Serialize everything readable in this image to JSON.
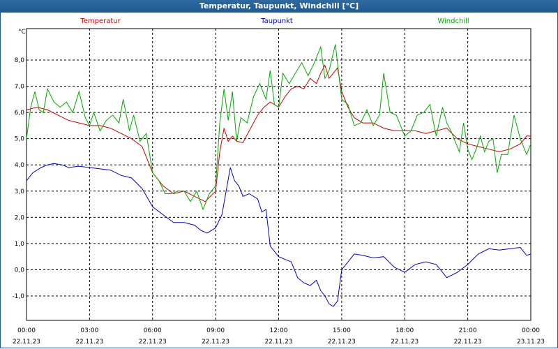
{
  "window": {
    "title": "Temperatur, Taupunkt, Windchill [°C]"
  },
  "chart_data": {
    "type": "line",
    "title": "Temperatur, Taupunkt, Windchill [°C]",
    "ylabel": "°C",
    "ylim": [
      -2.0,
      9.0
    ],
    "yticks": [
      -1.0,
      0.0,
      1.0,
      2.0,
      3.0,
      4.0,
      5.0,
      6.0,
      7.0,
      8.0
    ],
    "ytick_labels": [
      "-1,0",
      "0,0",
      "1,0",
      "2,0",
      "3,0",
      "4,0",
      "5,0",
      "6,0",
      "7,0",
      "8,0"
    ],
    "xlim": [
      0,
      24
    ],
    "xticks": [
      {
        "time": "00:00",
        "date": "22.11.23"
      },
      {
        "time": "03:00",
        "date": "22.11.23"
      },
      {
        "time": "06:00",
        "date": "22.11.23"
      },
      {
        "time": "09:00",
        "date": "22.11.23"
      },
      {
        "time": "12:00",
        "date": "22.11.23"
      },
      {
        "time": "15:00",
        "date": "22.11.23"
      },
      {
        "time": "18:00",
        "date": "22.11.23"
      },
      {
        "time": "21:00",
        "date": "22.11.23"
      },
      {
        "time": "00:00",
        "date": "23.11.23"
      }
    ],
    "grid": true,
    "legend_position": "top",
    "series": [
      {
        "name": "Temperatur",
        "color": "#cc0000",
        "points": [
          [
            0,
            6.1
          ],
          [
            0.5,
            6.2
          ],
          [
            1,
            6.1
          ],
          [
            1.5,
            5.9
          ],
          [
            2,
            5.7
          ],
          [
            2.5,
            5.6
          ],
          [
            3,
            5.5
          ],
          [
            3.5,
            5.5
          ],
          [
            4,
            5.4
          ],
          [
            4.5,
            5.2
          ],
          [
            5,
            5.0
          ],
          [
            5.5,
            4.7
          ],
          [
            6,
            3.7
          ],
          [
            6.5,
            3.2
          ],
          [
            7,
            2.9
          ],
          [
            7.5,
            3.0
          ],
          [
            8,
            2.8
          ],
          [
            8.5,
            2.6
          ],
          [
            9,
            3.0
          ],
          [
            9.2,
            4.5
          ],
          [
            9.4,
            5.4
          ],
          [
            9.6,
            4.9
          ],
          [
            9.8,
            5.1
          ],
          [
            10,
            4.9
          ],
          [
            10.3,
            4.85
          ],
          [
            10.6,
            5.3
          ],
          [
            11,
            5.9
          ],
          [
            11.3,
            6.2
          ],
          [
            11.6,
            6.4
          ],
          [
            12,
            6.2
          ],
          [
            12.3,
            6.6
          ],
          [
            12.6,
            6.9
          ],
          [
            12.9,
            7.0
          ],
          [
            13.2,
            6.9
          ],
          [
            13.5,
            7.3
          ],
          [
            13.8,
            7.1
          ],
          [
            14,
            7.5
          ],
          [
            14.2,
            7.8
          ],
          [
            14.4,
            7.3
          ],
          [
            14.6,
            7.5
          ],
          [
            14.8,
            7.7
          ],
          [
            15,
            6.8
          ],
          [
            15.3,
            6.2
          ],
          [
            15.6,
            5.8
          ],
          [
            16,
            5.6
          ],
          [
            16.5,
            5.6
          ],
          [
            17,
            5.4
          ],
          [
            17.5,
            5.3
          ],
          [
            18,
            5.3
          ],
          [
            18.5,
            5.3
          ],
          [
            19,
            5.2
          ],
          [
            19.5,
            5.3
          ],
          [
            20,
            5.4
          ],
          [
            20.5,
            5.0
          ],
          [
            21,
            4.8
          ],
          [
            21.5,
            4.7
          ],
          [
            22,
            4.6
          ],
          [
            22.5,
            4.5
          ],
          [
            23,
            4.6
          ],
          [
            23.5,
            4.8
          ],
          [
            23.8,
            5.1
          ],
          [
            24,
            5.1
          ]
        ]
      },
      {
        "name": "Taupunkt",
        "color": "#0000cc",
        "points": [
          [
            0,
            3.4
          ],
          [
            0.3,
            3.7
          ],
          [
            0.7,
            3.9
          ],
          [
            1,
            4.0
          ],
          [
            1.3,
            4.05
          ],
          [
            1.7,
            4.0
          ],
          [
            2,
            3.9
          ],
          [
            2.5,
            3.95
          ],
          [
            3,
            3.9
          ],
          [
            3.5,
            3.85
          ],
          [
            4,
            3.8
          ],
          [
            4.5,
            3.6
          ],
          [
            5,
            3.5
          ],
          [
            5.5,
            3.1
          ],
          [
            6,
            2.4
          ],
          [
            6.5,
            2.1
          ],
          [
            7,
            1.8
          ],
          [
            7.5,
            1.8
          ],
          [
            8,
            1.7
          ],
          [
            8.3,
            1.5
          ],
          [
            8.6,
            1.4
          ],
          [
            9,
            1.6
          ],
          [
            9.3,
            2.1
          ],
          [
            9.5,
            3.0
          ],
          [
            9.7,
            3.9
          ],
          [
            9.9,
            3.4
          ],
          [
            10.1,
            3.2
          ],
          [
            10.3,
            2.8
          ],
          [
            10.6,
            2.9
          ],
          [
            11,
            2.7
          ],
          [
            11.2,
            2.2
          ],
          [
            11.4,
            2.3
          ],
          [
            11.6,
            0.9
          ],
          [
            12,
            0.5
          ],
          [
            12.3,
            0.4
          ],
          [
            12.6,
            0.3
          ],
          [
            12.9,
            -0.3
          ],
          [
            13.2,
            -0.5
          ],
          [
            13.5,
            -0.6
          ],
          [
            13.8,
            -0.4
          ],
          [
            14,
            -0.8
          ],
          [
            14.2,
            -1.0
          ],
          [
            14.4,
            -1.3
          ],
          [
            14.6,
            -1.4
          ],
          [
            14.8,
            -1.2
          ],
          [
            15,
            0.0
          ],
          [
            15.3,
            0.3
          ],
          [
            15.6,
            0.6
          ],
          [
            16,
            0.55
          ],
          [
            16.5,
            0.45
          ],
          [
            17,
            0.5
          ],
          [
            17.5,
            0.1
          ],
          [
            18,
            -0.1
          ],
          [
            18.5,
            0.2
          ],
          [
            19,
            0.3
          ],
          [
            19.5,
            0.2
          ],
          [
            20,
            -0.3
          ],
          [
            20.5,
            -0.1
          ],
          [
            21,
            0.2
          ],
          [
            21.5,
            0.6
          ],
          [
            22,
            0.8
          ],
          [
            22.5,
            0.75
          ],
          [
            23,
            0.8
          ],
          [
            23.5,
            0.85
          ],
          [
            23.8,
            0.55
          ],
          [
            24,
            0.6
          ]
        ]
      },
      {
        "name": "Windchill",
        "color": "#00aa00",
        "points": [
          [
            0,
            5.0
          ],
          [
            0.2,
            6.2
          ],
          [
            0.4,
            6.8
          ],
          [
            0.6,
            6.1
          ],
          [
            0.8,
            6.0
          ],
          [
            1,
            6.9
          ],
          [
            1.3,
            6.4
          ],
          [
            1.6,
            6.2
          ],
          [
            1.9,
            6.4
          ],
          [
            2.2,
            6.0
          ],
          [
            2.5,
            6.8
          ],
          [
            2.8,
            5.8
          ],
          [
            3,
            5.5
          ],
          [
            3.2,
            6.0
          ],
          [
            3.5,
            5.3
          ],
          [
            3.8,
            5.7
          ],
          [
            4.1,
            5.9
          ],
          [
            4.4,
            5.6
          ],
          [
            4.6,
            6.5
          ],
          [
            4.9,
            5.3
          ],
          [
            5.1,
            5.9
          ],
          [
            5.4,
            4.9
          ],
          [
            5.7,
            5.2
          ],
          [
            6,
            3.7
          ],
          [
            6.3,
            3.4
          ],
          [
            6.6,
            2.9
          ],
          [
            6.9,
            2.9
          ],
          [
            7.2,
            3.0
          ],
          [
            7.5,
            3.0
          ],
          [
            7.8,
            2.6
          ],
          [
            8.1,
            3.0
          ],
          [
            8.4,
            2.3
          ],
          [
            8.7,
            2.9
          ],
          [
            9,
            3.2
          ],
          [
            9.2,
            5.6
          ],
          [
            9.4,
            6.9
          ],
          [
            9.6,
            5.7
          ],
          [
            9.8,
            6.8
          ],
          [
            10,
            4.9
          ],
          [
            10.2,
            5.8
          ],
          [
            10.5,
            5.6
          ],
          [
            10.8,
            6.6
          ],
          [
            11.1,
            7.1
          ],
          [
            11.4,
            6.5
          ],
          [
            11.6,
            7.6
          ],
          [
            11.8,
            6.3
          ],
          [
            12,
            6.2
          ],
          [
            12.2,
            7.5
          ],
          [
            12.5,
            7.1
          ],
          [
            12.8,
            7.5
          ],
          [
            13.1,
            7.9
          ],
          [
            13.4,
            7.4
          ],
          [
            13.7,
            7.9
          ],
          [
            14,
            8.5
          ],
          [
            14.2,
            7.3
          ],
          [
            14.4,
            7.6
          ],
          [
            14.7,
            8.6
          ],
          [
            15,
            6.5
          ],
          [
            15.3,
            6.3
          ],
          [
            15.6,
            5.5
          ],
          [
            15.9,
            5.6
          ],
          [
            16.2,
            6.1
          ],
          [
            16.5,
            5.5
          ],
          [
            16.8,
            5.9
          ],
          [
            17,
            7.5
          ],
          [
            17.3,
            6.0
          ],
          [
            17.6,
            5.9
          ],
          [
            18,
            5.1
          ],
          [
            18.3,
            5.3
          ],
          [
            18.6,
            5.9
          ],
          [
            18.9,
            6.0
          ],
          [
            19.2,
            6.3
          ],
          [
            19.5,
            5.1
          ],
          [
            19.8,
            6.2
          ],
          [
            20,
            5.6
          ],
          [
            20.2,
            5.3
          ],
          [
            20.4,
            4.9
          ],
          [
            20.6,
            4.5
          ],
          [
            20.8,
            5.6
          ],
          [
            21,
            4.6
          ],
          [
            21.2,
            4.2
          ],
          [
            21.4,
            4.6
          ],
          [
            21.6,
            5.1
          ],
          [
            21.8,
            4.5
          ],
          [
            22,
            4.9
          ],
          [
            22.2,
            5.0
          ],
          [
            22.4,
            3.7
          ],
          [
            22.6,
            4.4
          ],
          [
            22.9,
            4.4
          ],
          [
            23.2,
            5.9
          ],
          [
            23.5,
            5.0
          ],
          [
            23.8,
            4.4
          ],
          [
            24,
            4.8
          ]
        ]
      }
    ]
  }
}
